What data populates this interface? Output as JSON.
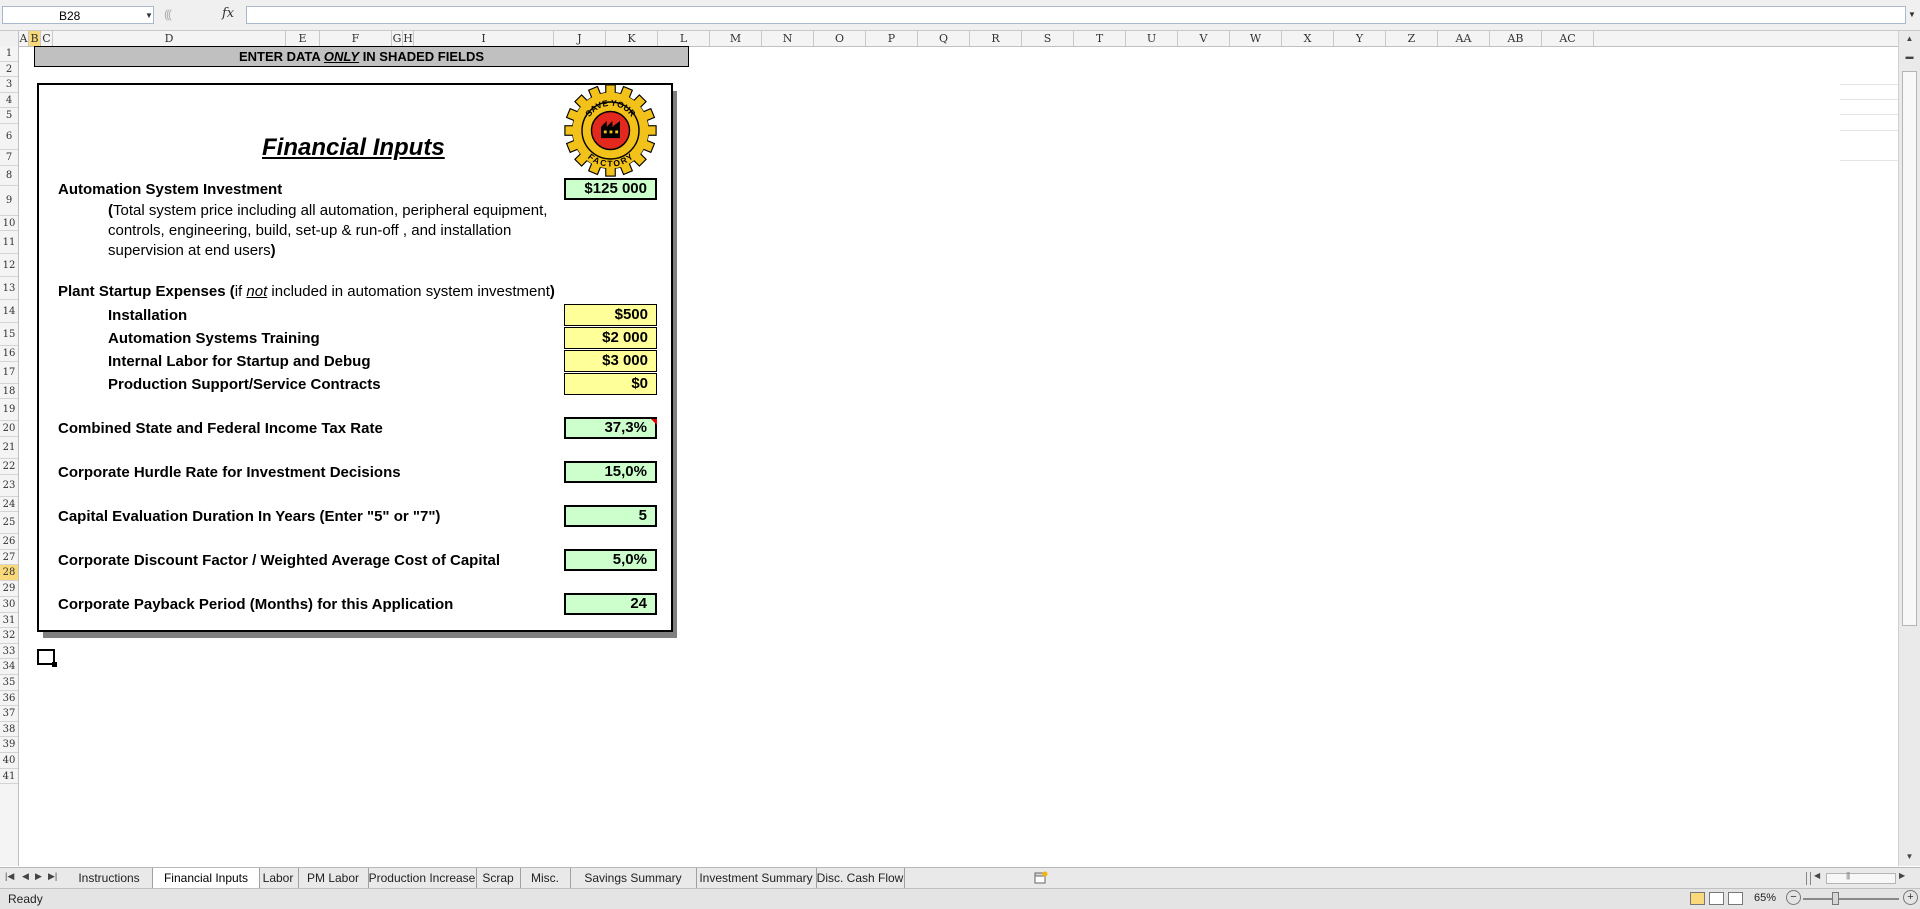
{
  "formula_bar": {
    "name_box": "B28",
    "fx_label": "fx",
    "formula": ""
  },
  "columns": [
    "A",
    "B",
    "C",
    "D",
    "E",
    "F",
    "G",
    "H",
    "I",
    "J",
    "K",
    "L",
    "M",
    "N",
    "O",
    "P",
    "Q",
    "R",
    "S",
    "T",
    "U",
    "V",
    "W",
    "X",
    "Y",
    "Z",
    "AA",
    "AB",
    "AC"
  ],
  "rows": [
    "1",
    "2",
    "3",
    "4",
    "5",
    "6",
    "7",
    "8",
    "9",
    "10",
    "11",
    "12",
    "13",
    "14",
    "15",
    "16",
    "17",
    "18",
    "19",
    "20",
    "21",
    "22",
    "23",
    "24",
    "25",
    "26",
    "27",
    "28",
    "29",
    "30",
    "31",
    "32",
    "33",
    "34",
    "35",
    "36",
    "37",
    "38",
    "39",
    "40",
    "41"
  ],
  "selected": {
    "column": "B",
    "row": "28"
  },
  "banner": {
    "prefix": "ENTER DATA ",
    "emphasis": "ONLY",
    "suffix": " IN SHADED FIELDS"
  },
  "panel": {
    "title": "Financial Inputs",
    "logo": {
      "icon": "save-your-factory-gear-logo",
      "text_top": "SAVE YOUR",
      "text_bottom": "FACTORY"
    },
    "investment": {
      "label": "Automation System Investment",
      "value": "$125 000",
      "note_open": "(",
      "note": "Total system price including all automation, peripheral equipment, controls, engineering, build, set-up & run-off , and installation supervision at end users",
      "note_close": ")"
    },
    "startup": {
      "label": "Plant Startup Expenses (",
      "qual_pre": "if ",
      "qual_em": "not",
      "qual_post": "  included in automation system investment",
      "close": ")",
      "items": [
        {
          "label": "Installation",
          "value": "$500"
        },
        {
          "label": "Automation Systems Training",
          "value": "$2 000"
        },
        {
          "label": "Internal Labor for Startup and Debug",
          "value": "$3 000"
        },
        {
          "label": "Production Support/Service Contracts",
          "value": "$0"
        }
      ]
    },
    "tax": {
      "label": "Combined State and Federal Income Tax Rate",
      "value": "37,3%"
    },
    "hurdle": {
      "label": "Corporate Hurdle Rate for Investment Decisions",
      "value": "15,0%"
    },
    "duration": {
      "label": "Capital Evaluation Duration In Years (Enter \"5\" or \"7\")",
      "value": "5"
    },
    "discount": {
      "label": "Corporate Discount Factor / Weighted Average Cost of Capital",
      "value": "5,0%"
    },
    "payback": {
      "label": "Corporate Payback Period (Months) for this Application",
      "value": "24"
    }
  },
  "colors": {
    "input_green": "#ccffcc",
    "input_yellow": "#ffff99",
    "banner_gray": "#c0c0c0",
    "selection": "#f9d97a"
  },
  "sheet_tabs": [
    "Instructions",
    "Financial Inputs",
    "Labor",
    "PM Labor",
    "Production Increase",
    "Scrap",
    "Misc.",
    "Savings Summary",
    "Investment Summary",
    "Disc. Cash Flow"
  ],
  "active_tab": "Financial Inputs",
  "status": {
    "text": "Ready",
    "zoom": "65%"
  }
}
